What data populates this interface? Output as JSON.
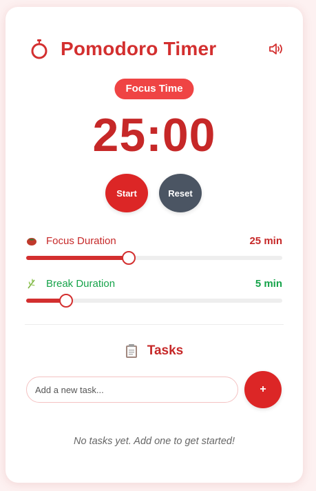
{
  "app": {
    "title": "Pomodoro Timer",
    "logo_icon": "stopwatch-icon",
    "sound_icon": "speaker-icon"
  },
  "timer": {
    "mode": "Focus Time",
    "display": "25:00"
  },
  "controls": {
    "start_label": "Start",
    "reset_label": "Reset"
  },
  "settings": {
    "focus": {
      "icon": "tomato-icon",
      "label": "Focus Duration",
      "value_label": "25 min",
      "minutes": 25,
      "slider_fraction": 0.4
    },
    "break": {
      "icon": "herb-icon",
      "label": "Break Duration",
      "value_label": "5 min",
      "minutes": 5,
      "slider_fraction": 0.155
    }
  },
  "tasks": {
    "icon": "clipboard-icon",
    "title": "Tasks",
    "input_placeholder": "Add a new task...",
    "input_value": "",
    "add_label": "+",
    "empty_message": "No tasks yet. Add one to get started!",
    "items": []
  },
  "colors": {
    "primary": "#d32f2f",
    "badge": "#ef4444",
    "reset": "#4b5563",
    "break": "#16a34a"
  }
}
